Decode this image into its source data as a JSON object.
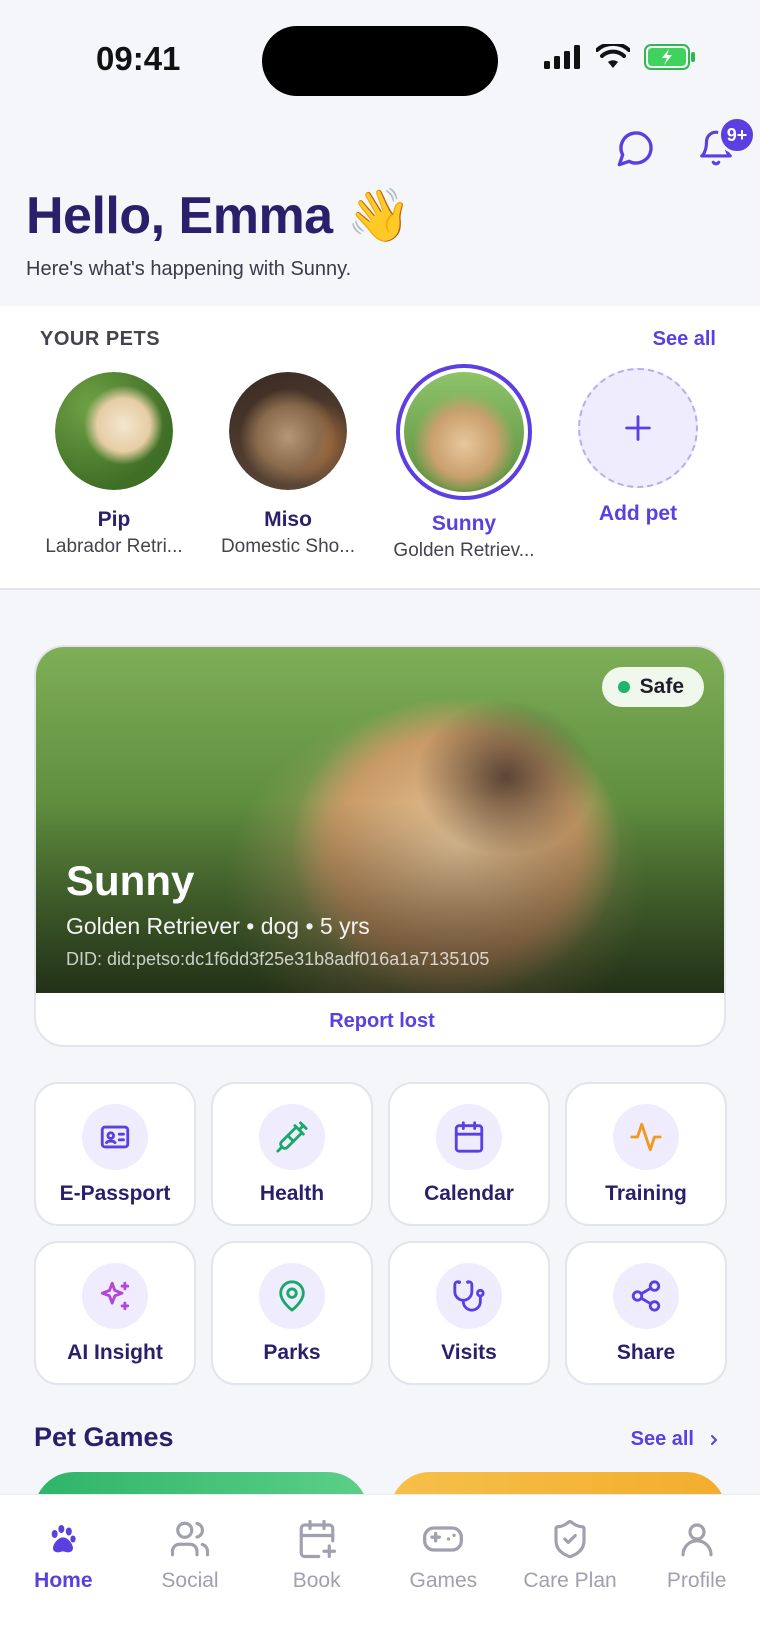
{
  "status": {
    "time": "09:41"
  },
  "header": {
    "notifications_badge": "9+",
    "greeting": "Hello, Emma 👋",
    "subtitle": "Here's what's happening with Sunny."
  },
  "pets": {
    "title": "YOUR PETS",
    "see_all": "See all",
    "items": [
      {
        "name": "Pip",
        "breed": "Labrador Retri..."
      },
      {
        "name": "Miso",
        "breed": "Domestic Sho..."
      },
      {
        "name": "Sunny",
        "breed": "Golden Retriev...",
        "selected": true
      }
    ],
    "add_label": "Add pet"
  },
  "hero": {
    "status": "Safe",
    "name": "Sunny",
    "meta": "Golden Retriever • dog • 5 yrs",
    "did": "DID: did:petso:dc1f6dd3f25e31b8adf016a1a7135105",
    "report_lost": "Report lost"
  },
  "actions": [
    {
      "label": "E-Passport",
      "icon": "id-card-icon"
    },
    {
      "label": "Health",
      "icon": "syringe-icon"
    },
    {
      "label": "Calendar",
      "icon": "calendar-icon"
    },
    {
      "label": "Training",
      "icon": "activity-icon"
    },
    {
      "label": "AI Insight",
      "icon": "sparkles-icon"
    },
    {
      "label": "Parks",
      "icon": "map-pin-icon"
    },
    {
      "label": "Visits",
      "icon": "stethoscope-icon"
    },
    {
      "label": "Share",
      "icon": "share-icon"
    }
  ],
  "games": {
    "title": "Pet Games",
    "see_all": "See all"
  },
  "tabs": [
    {
      "label": "Home",
      "active": true
    },
    {
      "label": "Social"
    },
    {
      "label": "Book"
    },
    {
      "label": "Games"
    },
    {
      "label": "Care Plan"
    },
    {
      "label": "Profile"
    }
  ],
  "colors": {
    "accent": "#5b3fe0",
    "heading": "#2a1f6b",
    "safe": "#1fb36b"
  }
}
